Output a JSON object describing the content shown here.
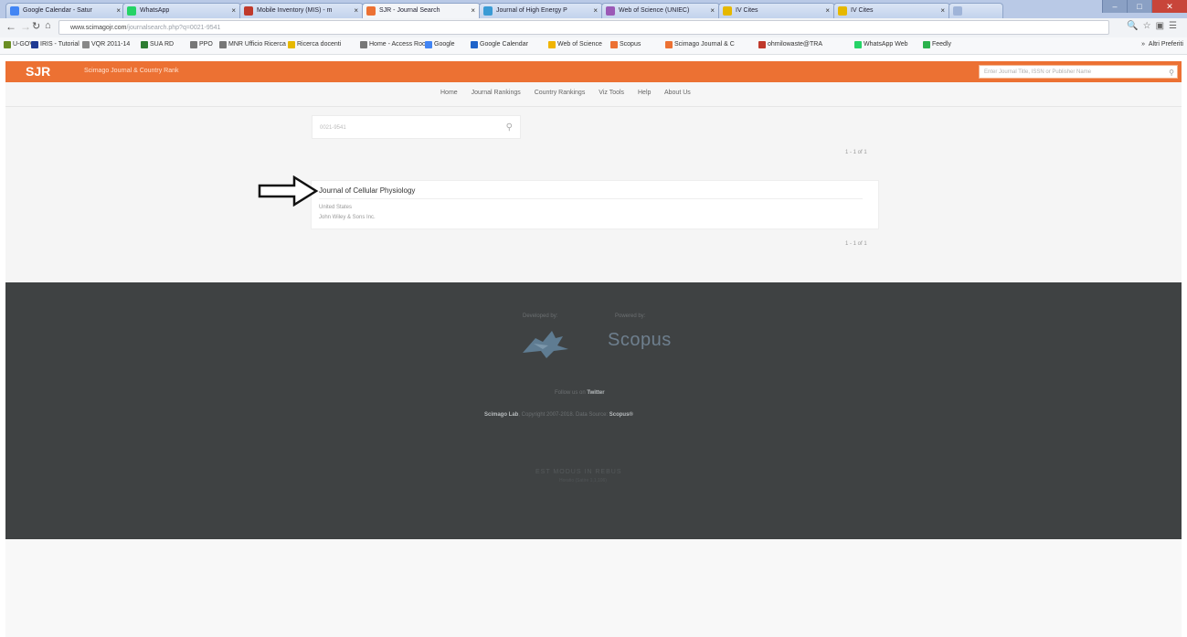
{
  "browser": {
    "tabs": [
      {
        "label": "Google Calendar - Satur",
        "color": "#4285f4"
      },
      {
        "label": "WhatsApp",
        "color": "#25d366"
      },
      {
        "label": "Mobile Inventory (MIS) - m",
        "color": "#c0392b"
      },
      {
        "label": "SJR - Journal Search",
        "color": "#ec7133"
      },
      {
        "label": "Journal of High Energy P",
        "color": "#3a9bd5"
      },
      {
        "label": "Web of Science (UNIEC)",
        "color": "#9b59b6"
      },
      {
        "label": "IV Cites",
        "color": "#e6b800"
      },
      {
        "label": "IV Cites",
        "color": "#e6b800"
      },
      {
        "label": "",
        "color": "#9fb4d8"
      }
    ],
    "url_main": "www.scimagojr.com",
    "url_rest": "/journalsearch.php?q=0021-9541",
    "bookmarks": [
      {
        "label": "U-GOV",
        "color": "#6b8e23"
      },
      {
        "label": "IRIS - Tutorial",
        "color": "#1f3a93"
      },
      {
        "label": "VQR 2011-14",
        "color": "#888888"
      },
      {
        "label": "SUA RD",
        "color": "#2e7d32"
      },
      {
        "label": "PPO",
        "color": "#777777"
      },
      {
        "label": "MNR Ufficio Ricerca",
        "color": "#777777"
      },
      {
        "label": "Ricerca docenti",
        "color": "#e6b800"
      },
      {
        "label": "Home - Access Roo",
        "color": "#777777"
      },
      {
        "label": "Google",
        "color": "#4285f4"
      },
      {
        "label": "Google Calendar",
        "color": "#1e63c9"
      },
      {
        "label": "Web of Science",
        "color": "#f0b400"
      },
      {
        "label": "Scopus",
        "color": "#ec7133"
      },
      {
        "label": "Scimago Journal & C",
        "color": "#ec7133"
      },
      {
        "label": "ohmilowaste@TRA",
        "color": "#c0392b"
      },
      {
        "label": "WhatsApp Web",
        "color": "#25d366"
      },
      {
        "label": "Feedly",
        "color": "#2bb24c"
      }
    ],
    "other_bookmarks": "Altri Preferiti"
  },
  "header": {
    "logo": "SJR",
    "tagline": "Scimago Journal & Country Rank",
    "search_placeholder": "Enter Journal Title, ISSN or Publisher Name"
  },
  "nav": {
    "items": [
      "Home",
      "Journal Rankings",
      "Country Rankings",
      "Viz Tools",
      "Help",
      "About Us"
    ]
  },
  "search": {
    "value": "0021-9541",
    "pager_top": "1 - 1 of 1",
    "pager_bottom": "1 - 1 of 1"
  },
  "result": {
    "title": "Journal of Cellular Physiology",
    "country": "United States",
    "publisher": "John Wiley & Sons Inc."
  },
  "footer": {
    "developed_by": "Developed by:",
    "powered_by": "Powered by:",
    "scopus": "Scopus",
    "follow": "Follow us on",
    "follow_link": "Twitter",
    "copyright_lab": "Scimago Lab",
    "copyright_text": ", Copyright 2007-2018. Data Source:",
    "copyright_source": "Scopus®",
    "brand": "EST MODUS IN REBUS",
    "brand_sub": "Horatio (Satire 1,1,106)"
  },
  "colors": {
    "accent": "#ec7133",
    "footer_bg": "#3f4243"
  }
}
